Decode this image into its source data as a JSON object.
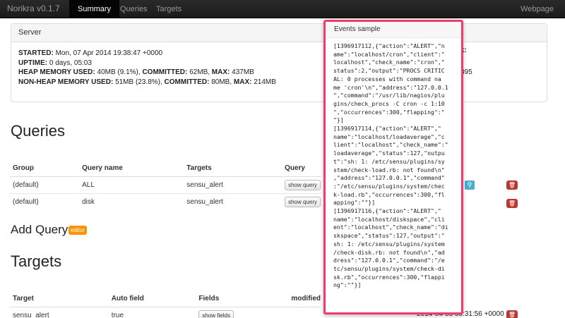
{
  "nav": {
    "brand": "Norikra v0.1.7",
    "tabs": [
      "Summary",
      "Queries",
      "Targets"
    ],
    "webpage": "Webpage"
  },
  "server": {
    "title": "Server",
    "started_label": "STARTED:",
    "started_value": "Mon, 07 Apr 2014 19:38:47 +0000",
    "uptime_label": "UPTIME:",
    "uptime_value": "0 days, 05:03",
    "heap_label": "HEAP MEMORY USED:",
    "heap_value": "40MB (9.1%),",
    "heap_committed_label": "COMMITTED:",
    "heap_committed_value": "62MB,",
    "heap_max_label": "MAX:",
    "heap_max_value": "437MB",
    "nonheap_label": "NON-HEAP MEMORY USED:",
    "nonheap_value": "51MB (23.8%),",
    "nonheap_committed_label": "COMMITTED:",
    "nonheap_committed_value": "80MB,",
    "nonheap_max_label": "MAX:",
    "nonheap_max_value": "214MB",
    "partial_right_1": "k:",
    "partial_right_2": "895"
  },
  "queries": {
    "heading": "Queries",
    "columns": [
      "Group",
      "Query name",
      "Targets",
      "Query"
    ],
    "rows": [
      {
        "group": "(default)",
        "name": "ALL",
        "target": "sensu_alert",
        "button": "show query"
      },
      {
        "group": "(default)",
        "name": "disk",
        "target": "sensu_alert",
        "button": "show query"
      }
    ]
  },
  "add_query": {
    "heading": "Add Query",
    "badge": "editor"
  },
  "targets": {
    "heading": "Targets",
    "columns": [
      "Target",
      "Auto field",
      "Fields",
      "modified"
    ],
    "rows": [
      {
        "target": "sensu_alert",
        "auto_field": "true",
        "button": "show fields",
        "modified_tail": "2014-04-08 00:31:56 +0000"
      }
    ]
  },
  "popover": {
    "title": "Events sample",
    "body": "[1396917112,{\"action\":\"ALERT\",\"n\name\":\"localhost/cron\",\"client\":\"\nlocalhost\",\"check_name\":\"cron\",\"\nstatus\":2,\"output\":\"PROCS CRITIC\nAL: 0 processes with command na\nme 'cron'\\n\",\"address\":\"127.0.0.1\n\",\"command\":\"/usr/lib/nagios/plu\ngins/check_procs -C cron -c 1:10\n\",\"occurrences\":300,\"flapping\":\"\n\"}]\n[1396917114,{\"action\":\"ALERT\",\"\nname\":\"localhost/loadaverage\",\"c\nlient\":\"localhost\",\"check_name\":\"\nloadaverage\",\"status\":127,\"outpu\nt\":\"sh: 1: /etc/sensu/plugins/sy\nstem/check-load.rb: not found\\n\"\n,\"address\":\"127.0.0.1\",\"command\"\n:\"/etc/sensu/plugins/system/chec\nk-load.rb\",\"occurrences\":300,\"fl\napping\":\"\"}]\n[1396917116,{\"action\":\"ALERT\",\"\nname\":\"localhost/diskspace\",\"cli\nent\":\"localhost\",\"check_name\":\"di\nskspace\",\"status\":127,\"output\":\"\nsh: 1: /etc/sensu/plugins/system\n/check-disk.rb: not found\\n\",\"ad\ndress\":\"127.0.0.1\",\"command\":\"/e\ntc/sensu/plugins/system/check-di\nsk.rb\",\"occurrences\":300,\"flappi\nng\":\"\"}]",
    "border_color": "#ef3c6b"
  },
  "colors": {
    "navbar": "#1b1b1b",
    "editor_badge": "#f89406",
    "search_button": "#49afcd",
    "delete_button": "#bd362f"
  }
}
